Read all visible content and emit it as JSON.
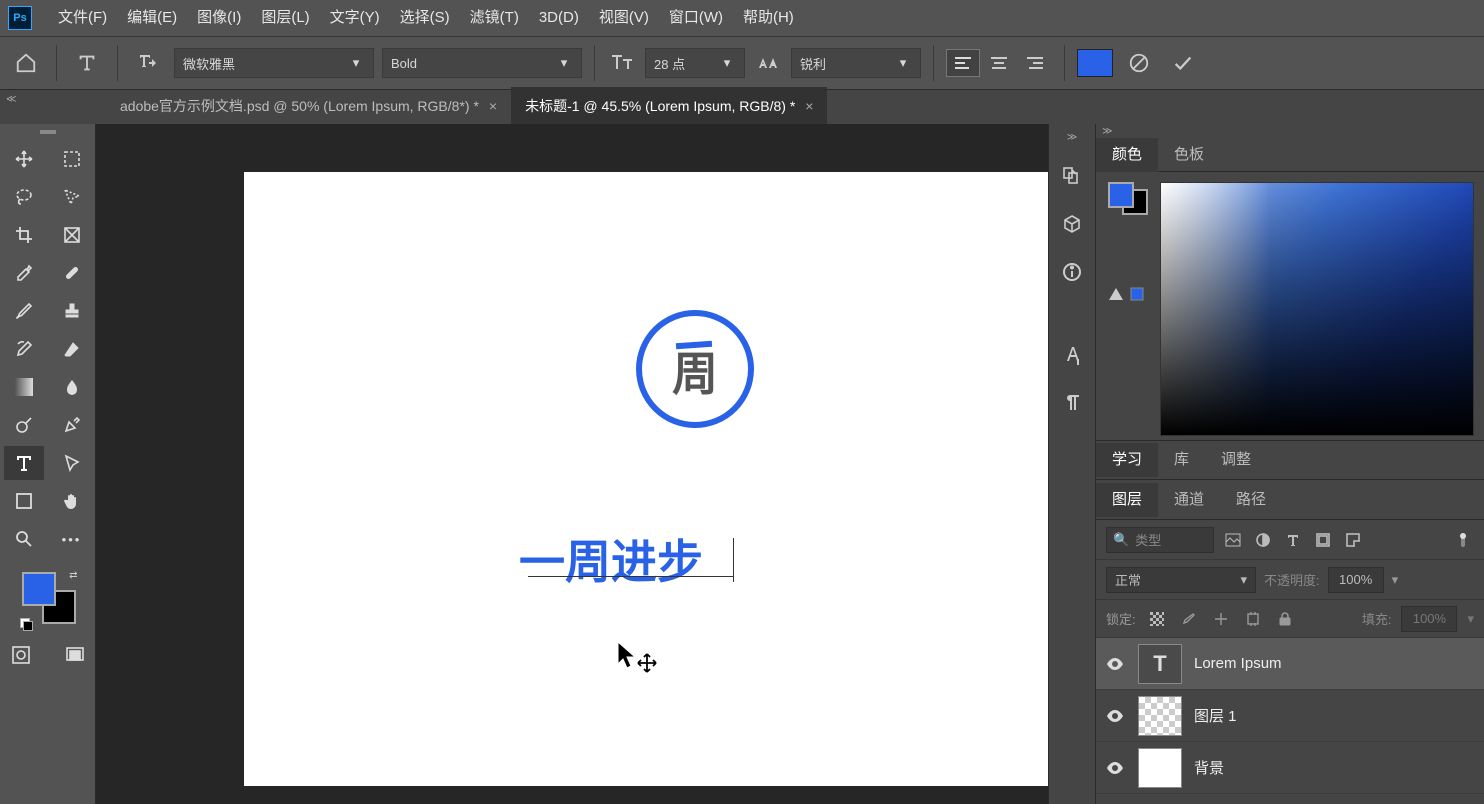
{
  "menubar": {
    "items": [
      "文件(F)",
      "编辑(E)",
      "图像(I)",
      "图层(L)",
      "文字(Y)",
      "选择(S)",
      "滤镜(T)",
      "3D(D)",
      "视图(V)",
      "窗口(W)",
      "帮助(H)"
    ]
  },
  "options": {
    "font_family": "微软雅黑",
    "font_weight": "Bold",
    "font_size": "28 点",
    "antialias": "锐利",
    "text_color": "#2962e6"
  },
  "tabs": [
    {
      "title": "adobe官方示例文档.psd @ 50% (Lorem Ipsum, RGB/8*) *",
      "active": false
    },
    {
      "title": "未标题-1 @ 45.5% (Lorem Ipsum, RGB/8) *",
      "active": true
    }
  ],
  "canvas": {
    "logo_char": "周",
    "text": "一周进步"
  },
  "panels": {
    "color_tab": "颜色",
    "swatch_tab": "色板",
    "learn_tab": "学习",
    "library_tab": "库",
    "adjust_tab": "调整",
    "layers_tab": "图层",
    "channels_tab": "通道",
    "paths_tab": "路径",
    "search_placeholder": "类型",
    "blend_mode": "正常",
    "opacity_label": "不透明度:",
    "opacity_value": "100%",
    "lock_label": "锁定:",
    "fill_label": "填充:",
    "fill_value": "100%",
    "layers": [
      {
        "name": "Lorem Ipsum",
        "type": "text",
        "selected": true
      },
      {
        "name": "图层 1",
        "type": "raster",
        "selected": false
      },
      {
        "name": "背景",
        "type": "bg",
        "selected": false
      }
    ]
  },
  "ps_logo": "Ps"
}
